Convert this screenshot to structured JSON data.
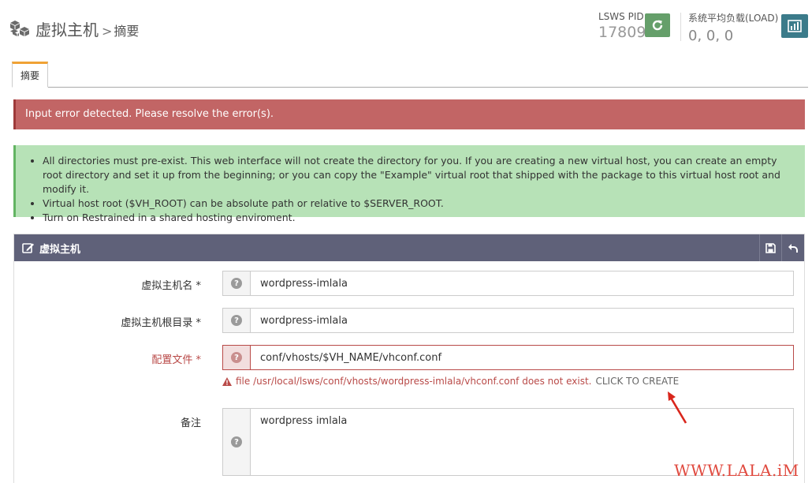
{
  "header": {
    "title": "虚拟主机",
    "separator": ">",
    "subtitle": "摘要",
    "pid_label": "LSWS PID",
    "pid_value": "17809",
    "load_label": "系统平均负载(LOAD)",
    "load_value": "0, 0, 0"
  },
  "tabs": [
    {
      "label": "摘要"
    }
  ],
  "alerts": {
    "error": "Input error detected. Please resolve the error(s).",
    "info": [
      "All directories must pre-exist. This web interface will not create the directory for you. If you are creating a new virtual host, you can create an empty root directory and set it up from the beginning; or you can copy the \"Example\" virtual root that shipped with the package to this virtual host root and modify it.",
      "Virtual host root ($VH_ROOT) can be absolute path or relative to $SERVER_ROOT.",
      "Turn on Restrained in a shared hosting enviroment."
    ]
  },
  "panel": {
    "title": "虚拟主机",
    "fields": [
      {
        "label": "虚拟主机名 *",
        "value": "wordpress-imlala"
      },
      {
        "label": "虚拟主机根目录 *",
        "value": "wordpress-imlala"
      },
      {
        "label": "配置文件 *",
        "value": "conf/vhosts/$VH_NAME/vhconf.conf"
      },
      {
        "label": "备注",
        "value": "wordpress imlala"
      }
    ],
    "error_message": "file /usr/local/lsws/conf/vhosts/wordpress-imlala/vhconf.conf does not exist.",
    "error_action": "CLICK TO CREATE"
  },
  "watermark": "WWW.LALA.iM",
  "colors": {
    "error_bg": "#c26565",
    "info_bg": "#b7e2b7",
    "panel_header": "#5f6179",
    "reload_btn": "#659f6a",
    "stats_btn": "#3b7b8a",
    "tab_accent": "#f0a235",
    "error_text": "#b94a48",
    "watermark": "#e04a3f"
  },
  "icons": {
    "brand": "cubes-icon",
    "reload": "refresh-icon",
    "stats": "bar-chart-icon",
    "panel": "edit-icon",
    "save": "save-icon",
    "back": "undo-icon",
    "help": "question-circle-icon",
    "warning": "warning-icon"
  }
}
